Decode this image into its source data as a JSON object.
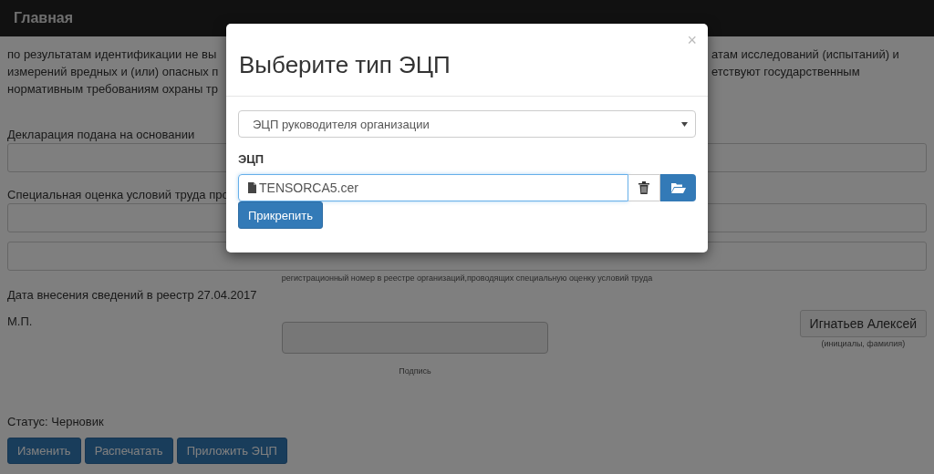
{
  "header": {
    "title": "Главная"
  },
  "intro_lines": [
    {
      "left": "по результатам идентификации не вы",
      "right": "атам исследований (испытаний) и"
    },
    {
      "left": "измерений вредных и (или) опасных п",
      "right": "етствуют государственным"
    },
    {
      "left": "нормативным требованиям охраны тр"
    }
  ],
  "basis": {
    "label": "Декларация подана на основании"
  },
  "assessment": {
    "label": "Специальная оценка условий труда про"
  },
  "registry_number": {
    "caption": "регистрационный номер в реестре организаций,проводящих специальную оценку условий труда"
  },
  "registry_date": "Дата внесения сведений в реестр 27.04.2017",
  "stamp_label": "М.П.",
  "signature": {
    "caption": "Подпись"
  },
  "signer": {
    "name": "Игнатьев Алексей",
    "caption": "(инициалы, фамилия)"
  },
  "status": "Статус: Черновик",
  "actions": [
    "Изменить",
    "Распечатать",
    "Приложить ЭЦП"
  ],
  "modal": {
    "title": "Выберите тип ЭЦП",
    "close": "×",
    "select": {
      "value": "ЭЦП руководителя организации"
    },
    "field_label": "ЭЦП",
    "file": {
      "value": "TENSORCA5.cer"
    },
    "attach_button": "Прикрепить"
  }
}
